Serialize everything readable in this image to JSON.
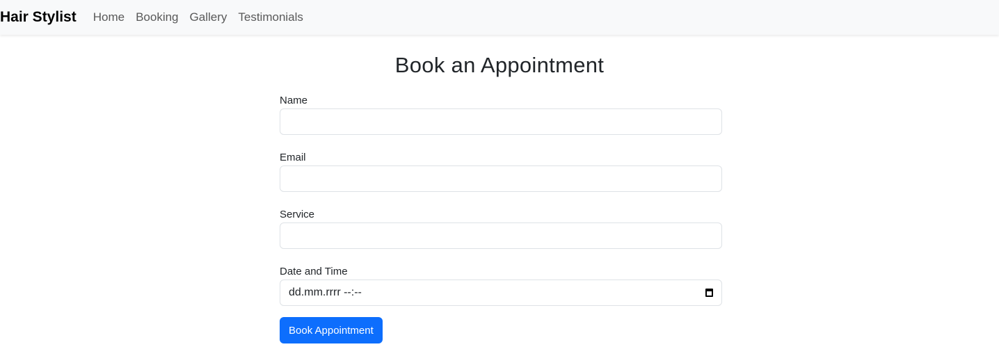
{
  "nav": {
    "brand": "Hair Stylist",
    "links": [
      "Home",
      "Booking",
      "Gallery",
      "Testimonials"
    ]
  },
  "page": {
    "title": "Book an Appointment"
  },
  "form": {
    "name_label": "Name",
    "email_label": "Email",
    "service_label": "Service",
    "datetime_label": "Date and Time",
    "datetime_placeholder": "dd.mm.rrrr --:--",
    "submit": "Book Appointment"
  }
}
